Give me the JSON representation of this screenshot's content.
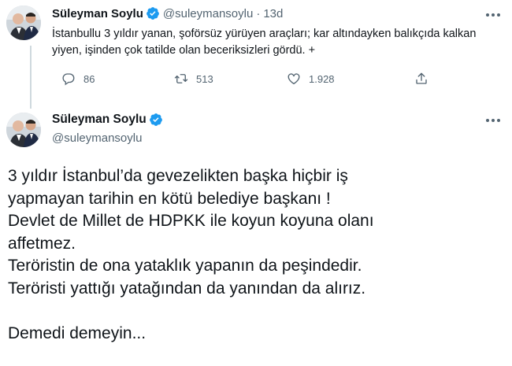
{
  "tweet1": {
    "name": "Süleyman Soylu",
    "handle": "@suleymansoylu",
    "separator": "·",
    "time": "13d",
    "text": "İstanbullu 3 yıldır yanan, şoförsüz yürüyen araçları; kar altındayken balıkçıda kalkan yiyen, işinden çok tatilde olan beceriksizleri gördü. +",
    "replies": "86",
    "retweets": "513",
    "likes": "1.928",
    "icons": [
      "reply-icon",
      "retweet-icon",
      "like-icon",
      "share-icon",
      "verified-badge-icon",
      "more-icon"
    ]
  },
  "tweet2": {
    "name": "Süleyman Soylu",
    "handle": "@suleymansoylu",
    "lines": [
      "3 yıldır İstanbul’da gevezelikten başka hiçbir iş",
      "yapmayan tarihin en kötü belediye başkanı !",
      "Devlet de Millet de HDPKK ile koyun koyuna olanı",
      "affetmez.",
      "Teröristin de ona yataklık yapanın da peşindedir.",
      "Teröristi yattığı yatağından da yanından da alırız.",
      "",
      "Demedi demeyin..."
    ]
  },
  "colors": {
    "text": "#0f1419",
    "secondary": "#536471",
    "verified": "#1d9bf0",
    "thread_line": "#cfd9de"
  }
}
